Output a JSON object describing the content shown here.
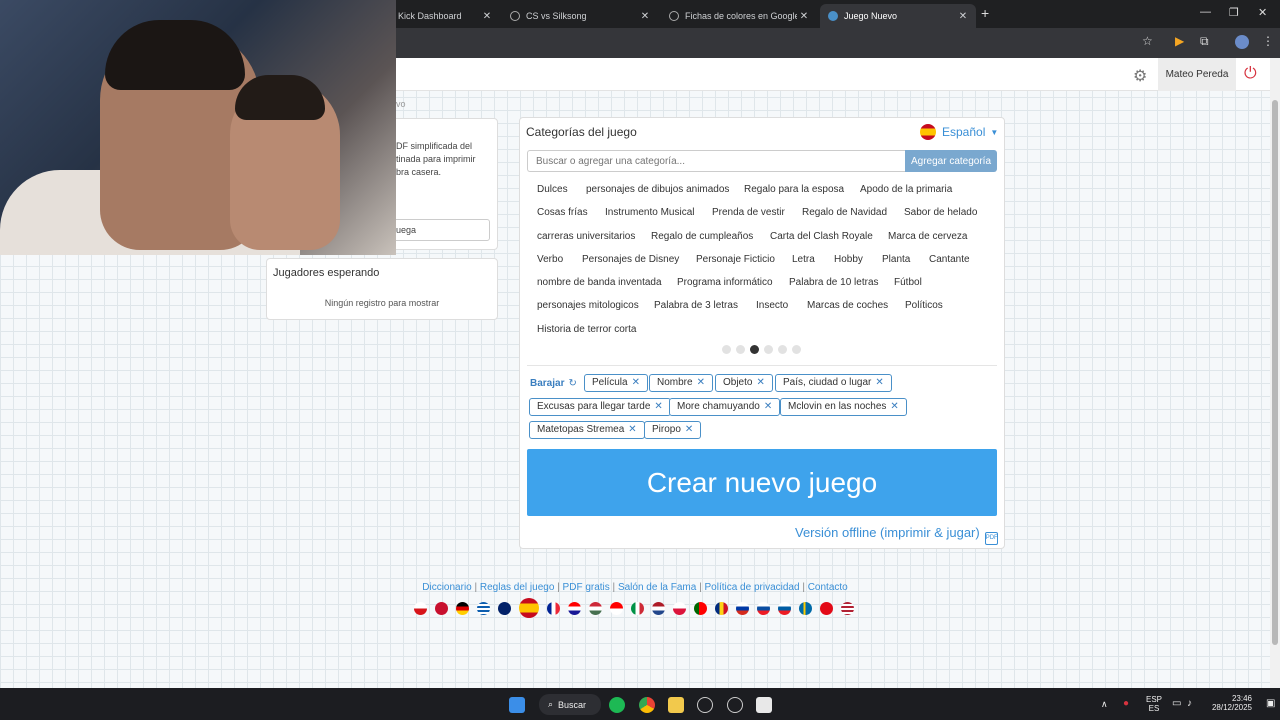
{
  "browser": {
    "tabs": [
      {
        "title": "Kick Dashboard",
        "active": false
      },
      {
        "title": "CS vs Silksong",
        "active": false
      },
      {
        "title": "Fichas de colores en Google - B",
        "active": false
      },
      {
        "title": "Juego Nuevo",
        "active": true
      }
    ],
    "new_tab": "+",
    "close": "✕"
  },
  "header": {
    "user_name": "Mateo Pereda",
    "gear_icon": "⚙",
    "power_icon": "⏻"
  },
  "left_panel": {
    "crumb": "vo",
    "description": "DF simplificada del\ntinada para imprimir\nbra casera.",
    "input_value": "uega",
    "waiting": {
      "title": "Jugadores esperando",
      "empty": "Ningún registro para mostrar"
    }
  },
  "main": {
    "title": "Categorías del juego",
    "language": "Español",
    "search_placeholder": "Buscar o agregar una categoría...",
    "add_label": "Agregar categoría",
    "categories": [
      "Dulces",
      "personajes de dibujos animados",
      "Regalo para la esposa",
      "Apodo de la primaria",
      "Cosas frías",
      "Instrumento Musical",
      "Prenda de vestir",
      "Regalo de Navidad",
      "Sabor de helado",
      "carreras universitarios",
      "Regalo de cumpleaños",
      "Carta del Clash Royale",
      "Marca de cerveza",
      "Verbo",
      "Personajes de Disney",
      "Personaje Ficticio",
      "Letra",
      "Hobby",
      "Planta",
      "Cantante",
      "nombre de banda inventada",
      "Programa informático",
      "Palabra de 10 letras",
      "Fútbol",
      "personajes mitologicos",
      "Palabra de 3 letras",
      "Insecto",
      "Marcas de coches",
      "Políticos",
      "Historia de terror corta"
    ],
    "pages": 6,
    "current_page": 3,
    "shuffle_label": "Barajar",
    "shuffle_icon": "↻",
    "selected": [
      "Película",
      "Nombre",
      "Objeto",
      "País, ciudad o lugar",
      "Excusas para llegar tarde",
      "More chamuyando",
      "Mclovin en las noches",
      "Matetopas Stremea",
      "Piropo"
    ],
    "remove_icon": "✕",
    "create_label": "Crear nuevo juego",
    "offline_label": "Versión offline (imprimir & jugar)",
    "offline_icon": "PDF"
  },
  "footer": {
    "links": [
      "Diccionario",
      "Reglas del juego",
      "PDF gratis",
      "Salón de la Fama",
      "Política de privacidad",
      "Contacto"
    ],
    "separator": "|"
  },
  "taskbar": {
    "search_label": "Buscar",
    "lang": "ESP",
    "lang_sub": "ES",
    "time": "23:46",
    "date": "28/12/2025"
  }
}
